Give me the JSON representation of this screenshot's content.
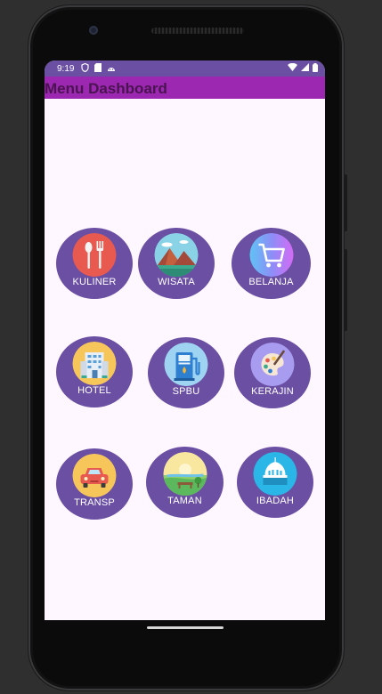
{
  "status": {
    "time": "9:19"
  },
  "appbar": {
    "title": "Menu Dashboard"
  },
  "menu": [
    {
      "label": "KULINER"
    },
    {
      "label": "WISATA"
    },
    {
      "label": "BELANJA"
    },
    {
      "label": "HOTEL"
    },
    {
      "label": "SPBU"
    },
    {
      "label": "KERAJIN"
    },
    {
      "label": "TRANSP"
    },
    {
      "label": "TAMAN"
    },
    {
      "label": "IBADAH"
    }
  ],
  "colors": {
    "tile": "#6a4fa3",
    "appbar": "#9c27b0",
    "status": "#6a4fa3",
    "screen": "#fef7ff"
  }
}
